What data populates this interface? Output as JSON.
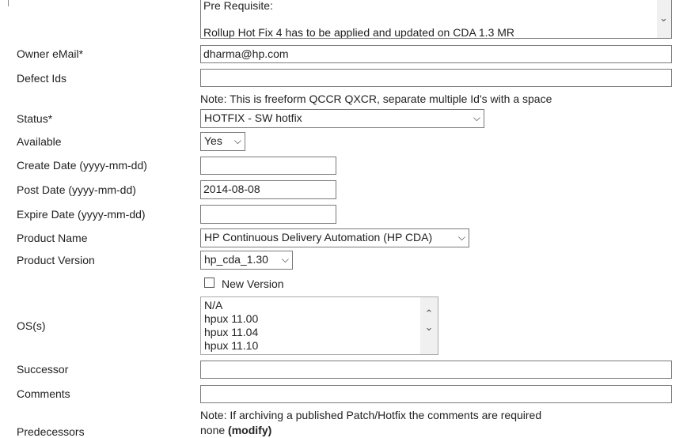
{
  "description_box": {
    "lines": [
      "Pre Requisite:",
      "",
      "Rollup Hot Fix 4 has to be applied and updated on CDA 1.3 MR"
    ]
  },
  "fields": {
    "owner_email": {
      "label": "Owner eMail*",
      "value": "dharma@hp.com"
    },
    "defect_ids": {
      "label": "Defect Ids",
      "value": "",
      "note": "Note: This is freeform QCCR QXCR, separate multiple Id's with a space"
    },
    "status": {
      "label": "Status*",
      "value": "HOTFIX - SW hotfix"
    },
    "available": {
      "label": "Available",
      "value": "Yes"
    },
    "create_date": {
      "label": "Create Date (yyyy-mm-dd)",
      "value": ""
    },
    "post_date": {
      "label": "Post Date (yyyy-mm-dd)",
      "value": "2014-08-08"
    },
    "expire_date": {
      "label": "Expire Date (yyyy-mm-dd)",
      "value": ""
    },
    "product_name": {
      "label": "Product Name",
      "value": "HP Continuous Delivery Automation (HP CDA)"
    },
    "product_version": {
      "label": "Product Version",
      "value": "hp_cda_1.30",
      "new_version_label": "New Version",
      "new_version_checked": false
    },
    "os": {
      "label": "OS(s)",
      "options": [
        "N/A",
        "hpux 11.00",
        "hpux 11.04",
        "hpux 11.10"
      ]
    },
    "successor": {
      "label": "Successor",
      "value": ""
    },
    "comments": {
      "label": "Comments",
      "value": "",
      "note": "Note: If archiving a published Patch/Hotfix the comments are required"
    },
    "predecessors": {
      "label": "Predecessors",
      "value": "none",
      "modify_link": "(modify)"
    }
  }
}
